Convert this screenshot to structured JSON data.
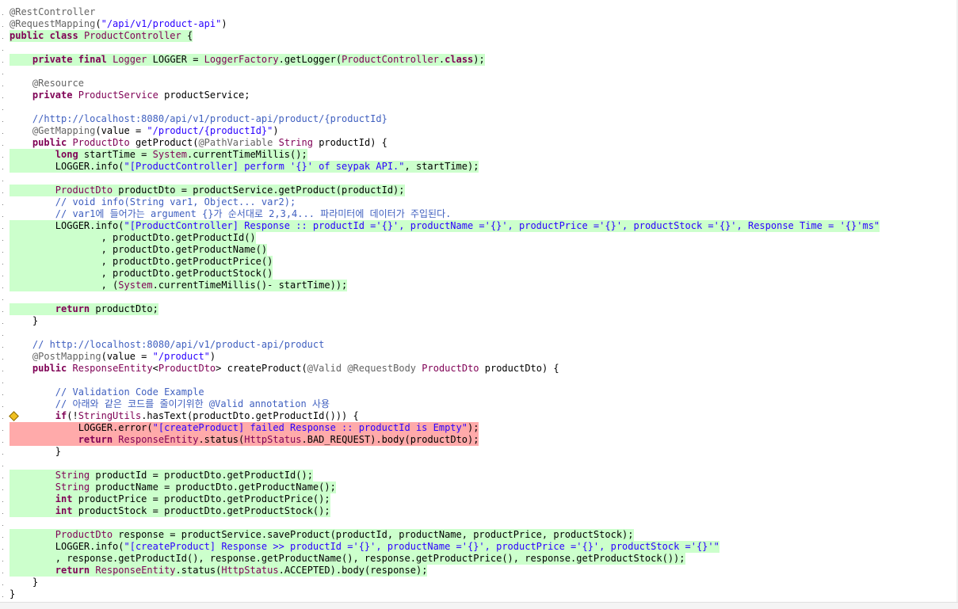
{
  "editor": {
    "lines": [
      {
        "hl": "",
        "segs": [
          {
            "c": "an",
            "t": "@RestController"
          }
        ]
      },
      {
        "hl": "",
        "segs": [
          {
            "c": "an",
            "t": "@RequestMapping"
          },
          {
            "c": "",
            "t": "("
          },
          {
            "c": "st",
            "t": "\"/api/v1/product-api\""
          },
          {
            "c": "",
            "t": ")"
          }
        ]
      },
      {
        "hl": "g",
        "segs": [
          {
            "c": "kw",
            "t": "public class"
          },
          {
            "c": "",
            "t": " "
          },
          {
            "c": "ty",
            "t": "ProductController"
          },
          {
            "c": "",
            "t": " {"
          }
        ]
      },
      {
        "hl": "",
        "segs": []
      },
      {
        "hl": "g",
        "segs": [
          {
            "c": "",
            "t": "    "
          },
          {
            "c": "kw",
            "t": "private final"
          },
          {
            "c": "",
            "t": " "
          },
          {
            "c": "ty",
            "t": "Logger"
          },
          {
            "c": "",
            "t": " LOGGER = "
          },
          {
            "c": "ty",
            "t": "LoggerFactory"
          },
          {
            "c": "",
            "t": ".getLogger("
          },
          {
            "c": "ty",
            "t": "ProductController"
          },
          {
            "c": "",
            "t": "."
          },
          {
            "c": "kw",
            "t": "class"
          },
          {
            "c": "",
            "t": ");"
          }
        ]
      },
      {
        "hl": "",
        "segs": []
      },
      {
        "hl": "",
        "segs": [
          {
            "c": "",
            "t": "    "
          },
          {
            "c": "an",
            "t": "@Resource"
          }
        ]
      },
      {
        "hl": "",
        "segs": [
          {
            "c": "",
            "t": "    "
          },
          {
            "c": "kw",
            "t": "private"
          },
          {
            "c": "",
            "t": " "
          },
          {
            "c": "ty",
            "t": "ProductService"
          },
          {
            "c": "",
            "t": " productService;"
          }
        ]
      },
      {
        "hl": "",
        "segs": []
      },
      {
        "hl": "",
        "segs": [
          {
            "c": "cm",
            "t": "    //http://localhost:8080/api/v1/product-api/product/{productId}"
          }
        ]
      },
      {
        "hl": "",
        "segs": [
          {
            "c": "",
            "t": "    "
          },
          {
            "c": "an",
            "t": "@GetMapping"
          },
          {
            "c": "",
            "t": "(value = "
          },
          {
            "c": "st",
            "t": "\"/product/{productId}\""
          },
          {
            "c": "",
            "t": ")"
          }
        ]
      },
      {
        "hl": "",
        "segs": [
          {
            "c": "",
            "t": "    "
          },
          {
            "c": "kw",
            "t": "public"
          },
          {
            "c": "",
            "t": " "
          },
          {
            "c": "ty",
            "t": "ProductDto"
          },
          {
            "c": "",
            "t": " getProduct("
          },
          {
            "c": "an",
            "t": "@PathVariable"
          },
          {
            "c": "",
            "t": " "
          },
          {
            "c": "ty",
            "t": "String"
          },
          {
            "c": "",
            "t": " productId) {"
          }
        ]
      },
      {
        "hl": "g",
        "segs": [
          {
            "c": "",
            "t": "        "
          },
          {
            "c": "kw",
            "t": "long"
          },
          {
            "c": "",
            "t": " startTime = "
          },
          {
            "c": "ty",
            "t": "System"
          },
          {
            "c": "",
            "t": ".currentTimeMillis();"
          }
        ]
      },
      {
        "hl": "g",
        "segs": [
          {
            "c": "",
            "t": "        LOGGER.info("
          },
          {
            "c": "st",
            "t": "\"[ProductController] perform '{}' of seypak API.\""
          },
          {
            "c": "",
            "t": ", startTime);"
          }
        ]
      },
      {
        "hl": "",
        "segs": []
      },
      {
        "hl": "g",
        "segs": [
          {
            "c": "",
            "t": "        "
          },
          {
            "c": "ty",
            "t": "ProductDto"
          },
          {
            "c": "",
            "t": " productDto = productService.getProduct(productId);"
          }
        ]
      },
      {
        "hl": "",
        "segs": [
          {
            "c": "cm",
            "t": "        // void info(String var1, Object... var2);"
          }
        ]
      },
      {
        "hl": "",
        "segs": [
          {
            "c": "cm",
            "t": "        // var1에 들어가는 argument {}가 순서대로 2,3,4... 파라미터에 데이터가 주입된다."
          }
        ]
      },
      {
        "hl": "g",
        "segs": [
          {
            "c": "",
            "t": "        LOGGER.info("
          },
          {
            "c": "st",
            "t": "\"[ProductController] Response :: productId ='{}', productName ='{}', productPrice ='{}', productStock ='{}', Response Time = '{}'ms\""
          }
        ]
      },
      {
        "hl": "g",
        "segs": [
          {
            "c": "",
            "t": "                , productDto.getProductId()"
          }
        ]
      },
      {
        "hl": "g",
        "segs": [
          {
            "c": "",
            "t": "                , productDto.getProductName()"
          }
        ]
      },
      {
        "hl": "g",
        "segs": [
          {
            "c": "",
            "t": "                , productDto.getProductPrice()"
          }
        ]
      },
      {
        "hl": "g",
        "segs": [
          {
            "c": "",
            "t": "                , productDto.getProductStock()"
          }
        ]
      },
      {
        "hl": "g",
        "segs": [
          {
            "c": "",
            "t": "                , ("
          },
          {
            "c": "ty",
            "t": "System"
          },
          {
            "c": "",
            "t": ".currentTimeMillis()- startTime));"
          }
        ]
      },
      {
        "hl": "",
        "segs": []
      },
      {
        "hl": "g",
        "segs": [
          {
            "c": "",
            "t": "        "
          },
          {
            "c": "kw",
            "t": "return"
          },
          {
            "c": "",
            "t": " productDto;"
          }
        ]
      },
      {
        "hl": "",
        "segs": [
          {
            "c": "",
            "t": "    }"
          }
        ]
      },
      {
        "hl": "",
        "segs": []
      },
      {
        "hl": "",
        "segs": [
          {
            "c": "cm",
            "t": "    // http://localhost:8080/api/v1/product-api/product"
          }
        ]
      },
      {
        "hl": "",
        "segs": [
          {
            "c": "",
            "t": "    "
          },
          {
            "c": "an",
            "t": "@PostMapping"
          },
          {
            "c": "",
            "t": "(value = "
          },
          {
            "c": "st",
            "t": "\"/product\""
          },
          {
            "c": "",
            "t": ")"
          }
        ]
      },
      {
        "hl": "",
        "segs": [
          {
            "c": "",
            "t": "    "
          },
          {
            "c": "kw",
            "t": "public"
          },
          {
            "c": "",
            "t": " "
          },
          {
            "c": "ty",
            "t": "ResponseEntity"
          },
          {
            "c": "",
            "t": "<"
          },
          {
            "c": "ty",
            "t": "ProductDto"
          },
          {
            "c": "",
            "t": "> createProduct("
          },
          {
            "c": "an",
            "t": "@Valid"
          },
          {
            "c": "",
            "t": " "
          },
          {
            "c": "an",
            "t": "@RequestBody"
          },
          {
            "c": "",
            "t": " "
          },
          {
            "c": "ty",
            "t": "ProductDto"
          },
          {
            "c": "",
            "t": " productDto) {"
          }
        ]
      },
      {
        "hl": "",
        "segs": []
      },
      {
        "hl": "",
        "segs": [
          {
            "c": "cm",
            "t": "        // Validation Code Example"
          }
        ]
      },
      {
        "hl": "",
        "segs": [
          {
            "c": "cm",
            "t": "        // 아래와 같은 코드를 줄이기위한 @Valid annotation 사용"
          }
        ]
      },
      {
        "hl": "",
        "marker": true,
        "segs": [
          {
            "c": "",
            "t": "        "
          },
          {
            "c": "kw",
            "t": "if"
          },
          {
            "c": "",
            "t": "(!"
          },
          {
            "c": "ty",
            "t": "StringUtils"
          },
          {
            "c": "",
            "t": ".hasText(productDto.getProductId())) {"
          }
        ]
      },
      {
        "hl": "r",
        "segs": [
          {
            "c": "",
            "t": "            LOGGER.error("
          },
          {
            "c": "st",
            "t": "\"[createProduct] failed Response :: productId is Empty\""
          },
          {
            "c": "",
            "t": ");"
          }
        ]
      },
      {
        "hl": "r",
        "segs": [
          {
            "c": "",
            "t": "            "
          },
          {
            "c": "kw",
            "t": "return"
          },
          {
            "c": "",
            "t": " "
          },
          {
            "c": "ty",
            "t": "ResponseEntity"
          },
          {
            "c": "",
            "t": ".status("
          },
          {
            "c": "ty",
            "t": "HttpStatus"
          },
          {
            "c": "",
            "t": ".BAD_REQUEST).body(productDto);"
          }
        ]
      },
      {
        "hl": "",
        "segs": [
          {
            "c": "",
            "t": "        }"
          }
        ]
      },
      {
        "hl": "",
        "segs": []
      },
      {
        "hl": "g",
        "segs": [
          {
            "c": "",
            "t": "        "
          },
          {
            "c": "ty",
            "t": "String"
          },
          {
            "c": "",
            "t": " productId = productDto.getProductId();"
          }
        ]
      },
      {
        "hl": "g",
        "segs": [
          {
            "c": "",
            "t": "        "
          },
          {
            "c": "ty",
            "t": "String"
          },
          {
            "c": "",
            "t": " productName = productDto.getProductName();"
          }
        ]
      },
      {
        "hl": "g",
        "segs": [
          {
            "c": "",
            "t": "        "
          },
          {
            "c": "kw",
            "t": "int"
          },
          {
            "c": "",
            "t": " productPrice = productDto.getProductPrice();"
          }
        ]
      },
      {
        "hl": "g",
        "segs": [
          {
            "c": "",
            "t": "        "
          },
          {
            "c": "kw",
            "t": "int"
          },
          {
            "c": "",
            "t": " productStock = productDto.getProductStock();"
          }
        ]
      },
      {
        "hl": "",
        "segs": []
      },
      {
        "hl": "g",
        "segs": [
          {
            "c": "",
            "t": "        "
          },
          {
            "c": "ty",
            "t": "ProductDto"
          },
          {
            "c": "",
            "t": " response = productService.saveProduct(productId, productName, productPrice, productStock);"
          }
        ]
      },
      {
        "hl": "g",
        "segs": [
          {
            "c": "",
            "t": "        LOGGER.info("
          },
          {
            "c": "st",
            "t": "\"[createProduct] Response >> productId ='{}', productName ='{}', productPrice ='{}', productStock ='{}'\""
          }
        ]
      },
      {
        "hl": "g",
        "segs": [
          {
            "c": "",
            "t": "        , response.getProductId(), response.getProductName(), response.getProductPrice(), response.getProductStock());"
          }
        ]
      },
      {
        "hl": "g",
        "segs": [
          {
            "c": "",
            "t": "        "
          },
          {
            "c": "kw",
            "t": "return"
          },
          {
            "c": "",
            "t": " "
          },
          {
            "c": "ty",
            "t": "ResponseEntity"
          },
          {
            "c": "",
            "t": ".status("
          },
          {
            "c": "ty",
            "t": "HttpStatus"
          },
          {
            "c": "",
            "t": ".ACCEPTED).body(response);"
          }
        ]
      },
      {
        "hl": "",
        "segs": [
          {
            "c": "",
            "t": "    }"
          }
        ]
      },
      {
        "hl": "",
        "segs": [
          {
            "c": "",
            "t": "}"
          }
        ]
      }
    ]
  },
  "marker_icon": "warning-diamond-icon",
  "colors": {
    "coverage_green": "#ccffcc",
    "coverage_red": "#ffaaaa",
    "keyword": "#7f0055",
    "string": "#2a00ff",
    "comment": "#3f5fbf",
    "annotation": "#646464"
  }
}
